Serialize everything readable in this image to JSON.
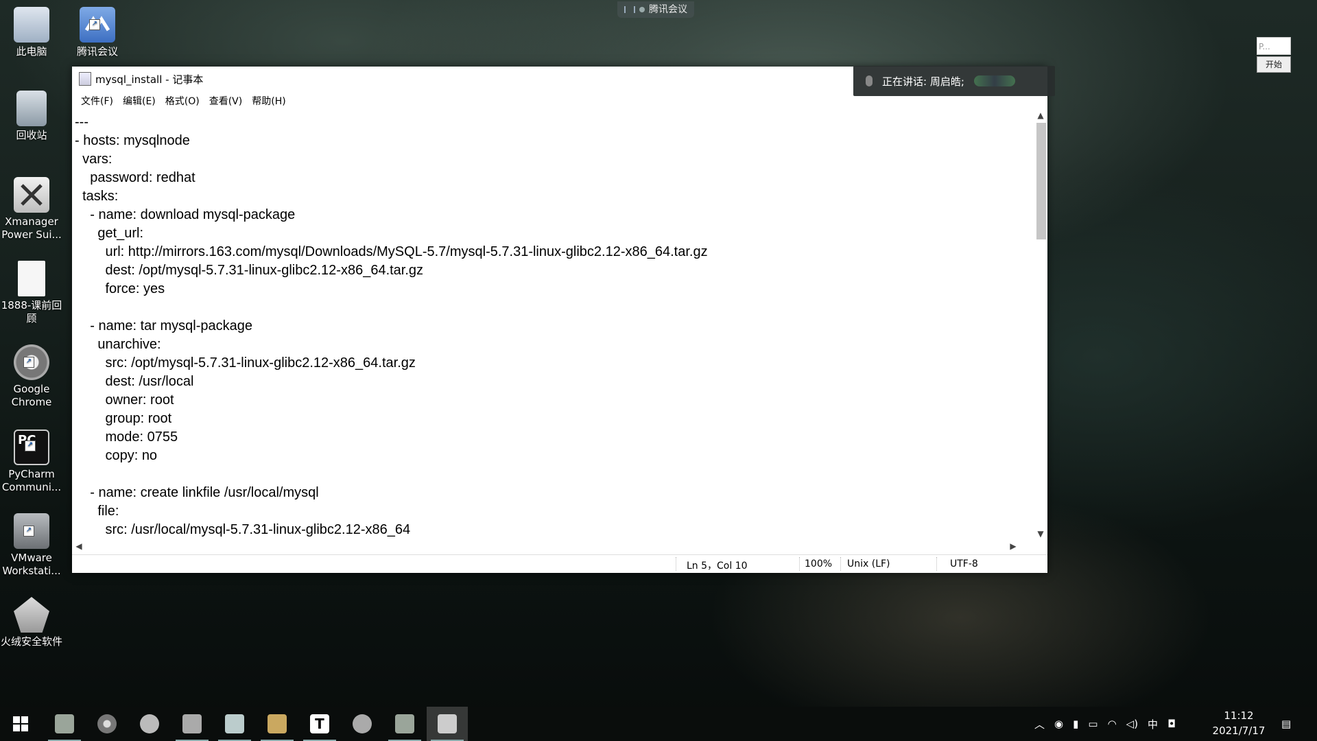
{
  "desktop_icons": [
    {
      "id": "this-pc",
      "label": "此电脑",
      "color": "#cfd8e6"
    },
    {
      "id": "tencent-meeting",
      "label": "腾讯会议",
      "color": "#5a8fd9"
    },
    {
      "id": "recycle-bin",
      "label": "回收站",
      "color": "#b7c3cf"
    },
    {
      "id": "xmanager",
      "label": "Xmanager Power Sui...",
      "color": "#e6e6e6"
    },
    {
      "id": "course-file",
      "label": "1888-课前回顾",
      "color": "#f4f4f4"
    },
    {
      "id": "google-chrome",
      "label": "Google Chrome",
      "color": "#9a9a9a"
    },
    {
      "id": "pycharm",
      "label": "PyCharm Communi...",
      "color": "#1e1e1e"
    },
    {
      "id": "vmware",
      "label": "VMware Workstati...",
      "color": "#888c90"
    },
    {
      "id": "huorong",
      "label": "火绒安全软件",
      "color": "#e05a2b"
    }
  ],
  "meeting_badge": {
    "label": "腾讯会议"
  },
  "mini_panel": {
    "input_text": "P...",
    "button_label": "开始"
  },
  "speaking": {
    "label": "正在讲话: 周启皓;"
  },
  "notepad": {
    "title": "mysql_install - 记事本",
    "menu": [
      "文件(F)",
      "编辑(E)",
      "格式(O)",
      "查看(V)",
      "帮助(H)"
    ],
    "content": "---\n- hosts: mysqlnode\n  vars:\n    password: redhat\n  tasks:\n    - name: download mysql-package\n      get_url:\n        url: http://mirrors.163.com/mysql/Downloads/MySQL-5.7/mysql-5.7.31-linux-glibc2.12-x86_64.tar.gz\n        dest: /opt/mysql-5.7.31-linux-glibc2.12-x86_64.tar.gz\n        force: yes\n\n    - name: tar mysql-package\n      unarchive:\n        src: /opt/mysql-5.7.31-linux-glibc2.12-x86_64.tar.gz\n        dest: /usr/local\n        owner: root\n        group: root\n        mode: 0755\n        copy: no\n\n    - name: create linkfile /usr/local/mysql\n      file:\n        src: /usr/local/mysql-5.7.31-linux-glibc2.12-x86_64",
    "status": {
      "position": "Ln 5，Col 10",
      "zoom": "100%",
      "line_ending": "Unix (LF)",
      "encoding": "UTF-8"
    }
  },
  "taskbar": {
    "apps": [
      {
        "id": "start",
        "icon": "windows-icon"
      },
      {
        "id": "app1",
        "icon": "image-app-icon",
        "color": "#9aa59a"
      },
      {
        "id": "app2",
        "icon": "chrome-icon",
        "color": "#888"
      },
      {
        "id": "app3",
        "icon": "wechat-icon",
        "color": "#bbb"
      },
      {
        "id": "app4",
        "icon": "vmware-icon",
        "color": "#aaa"
      },
      {
        "id": "app5",
        "icon": "tencent-meeting-icon",
        "color": "#bcc"
      },
      {
        "id": "app6",
        "icon": "folder-icon",
        "color": "#caa860"
      },
      {
        "id": "app7",
        "icon": "typora-icon",
        "color": "#fff"
      },
      {
        "id": "app8",
        "icon": "swirl-app-icon",
        "color": "#aaa"
      },
      {
        "id": "app9",
        "icon": "image-app-icon",
        "color": "#9aa59a"
      },
      {
        "id": "app10",
        "icon": "notepad-icon",
        "color": "#ccc"
      }
    ],
    "ime": "中",
    "time": "11:12",
    "date": "2021/7/17"
  }
}
